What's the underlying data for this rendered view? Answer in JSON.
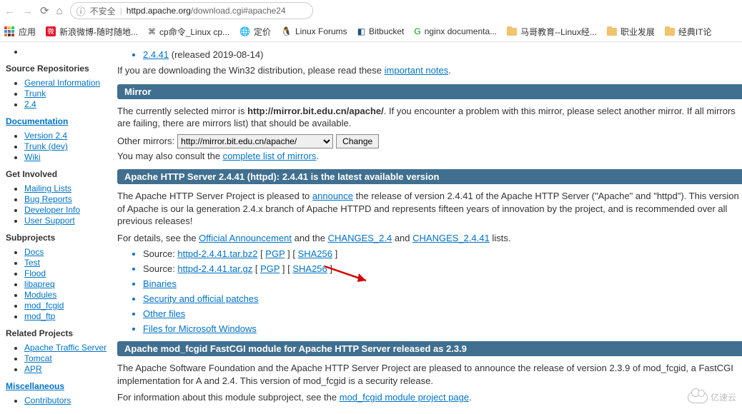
{
  "browser": {
    "security_label": "不安全",
    "url_host": "httpd.apache.org",
    "url_path": "/download.cgi#apache24",
    "bookmarks": [
      {
        "icon": "apps",
        "label": "应用"
      },
      {
        "icon": "weibo",
        "label": "新浪微博-随时随地..."
      },
      {
        "icon": "cmd",
        "label": "cp命令_Linux cp..."
      },
      {
        "icon": "globe",
        "label": "定价"
      },
      {
        "icon": "tux",
        "label": "Linux Forums"
      },
      {
        "icon": "bb",
        "label": "Bitbucket"
      },
      {
        "icon": "nginx",
        "label": "nginx documenta..."
      },
      {
        "icon": "folder",
        "label": "马哥教育--Linux经..."
      },
      {
        "icon": "folder",
        "label": "职业发展"
      },
      {
        "icon": "folder",
        "label": "经典IT论"
      }
    ]
  },
  "sidebar": {
    "source_repositories": {
      "title": "Source Repositories",
      "items": [
        "General Information",
        "Trunk",
        "2.4"
      ]
    },
    "documentation": {
      "title": "Documentation",
      "items": [
        "Version 2.4",
        "Trunk (dev)",
        "Wiki"
      ]
    },
    "get_involved": {
      "title": "Get Involved",
      "items": [
        "Mailing Lists",
        "Bug Reports",
        "Developer Info",
        "User Support"
      ]
    },
    "subprojects": {
      "title": "Subprojects",
      "items": [
        "Docs",
        "Test",
        "Flood",
        "libapreq",
        "Modules",
        "mod_fcgid",
        "mod_ftp"
      ]
    },
    "related_projects": {
      "title": "Related Projects",
      "items": [
        "Apache Traffic Server",
        "Tomcat",
        "APR"
      ]
    },
    "miscellaneous": {
      "title": "Miscellaneous",
      "items": [
        "Contributors"
      ]
    }
  },
  "main": {
    "top_release": {
      "link": "2.4.41",
      "suffix": " (released 2019-08-14)"
    },
    "win32_line_pre": "If you are downloading the Win32 distribution, please read these ",
    "win32_link": "important notes",
    "mirror_header": "Mirror",
    "mirror_text_pre": "The currently selected mirror is ",
    "mirror_text_bold": "http://mirror.bit.edu.cn/apache/",
    "mirror_text_post": ". If you encounter a problem with this mirror, please select another mirror. If all mirrors are failing, there are mirrors list) that should be available.",
    "other_mirrors_label": "Other mirrors:",
    "mirror_select_value": "http://mirror.bit.edu.cn/apache/",
    "change_button": "Change",
    "consult_pre": "You may also consult the ",
    "consult_link": "complete list of mirrors",
    "httpd_header": "Apache HTTP Server 2.4.41 (httpd): 2.4.41 is the latest available version",
    "httpd_para_pre": "The Apache HTTP Server Project is pleased to ",
    "httpd_para_link": "announce",
    "httpd_para_post": " the release of version 2.4.41 of the Apache HTTP Server (\"Apache\" and \"httpd\"). This version of Apache is our la generation 2.4.x branch of Apache HTTPD and represents fifteen years of innovation by the project, and is recommended over all previous releases!",
    "details_pre": "For details, see the ",
    "details_link1": "Official Announcement",
    "details_mid": " and the ",
    "details_link2": "CHANGES_2.4",
    "details_mid2": " and ",
    "details_link3": "CHANGES_2.4.41",
    "details_post": " lists.",
    "sources": [
      {
        "pre": "Source: ",
        "file": "httpd-2.4.41.tar.bz2",
        "pgp": "PGP",
        "sha": "SHA256"
      },
      {
        "pre": "Source: ",
        "file": "httpd-2.4.41.tar.gz",
        "pgp": "PGP",
        "sha": "SHA256"
      }
    ],
    "extra_links": [
      "Binaries",
      "Security and official patches",
      "Other files",
      "Files for Microsoft Windows"
    ],
    "fcgid_header": "Apache mod_fcgid FastCGI module for Apache HTTP Server released as 2.3.9",
    "fcgid_para": "The Apache Software Foundation and the Apache HTTP Server Project are pleased to announce the release of version 2.3.9 of mod_fcgid, a FastCGI implementation for A and 2.4. This version of mod_fcgid is a security release.",
    "fcgid_info_pre": "For information about this module subproject, see the ",
    "fcgid_info_link": "mod_fcgid module project page"
  },
  "watermark": "亿速云"
}
